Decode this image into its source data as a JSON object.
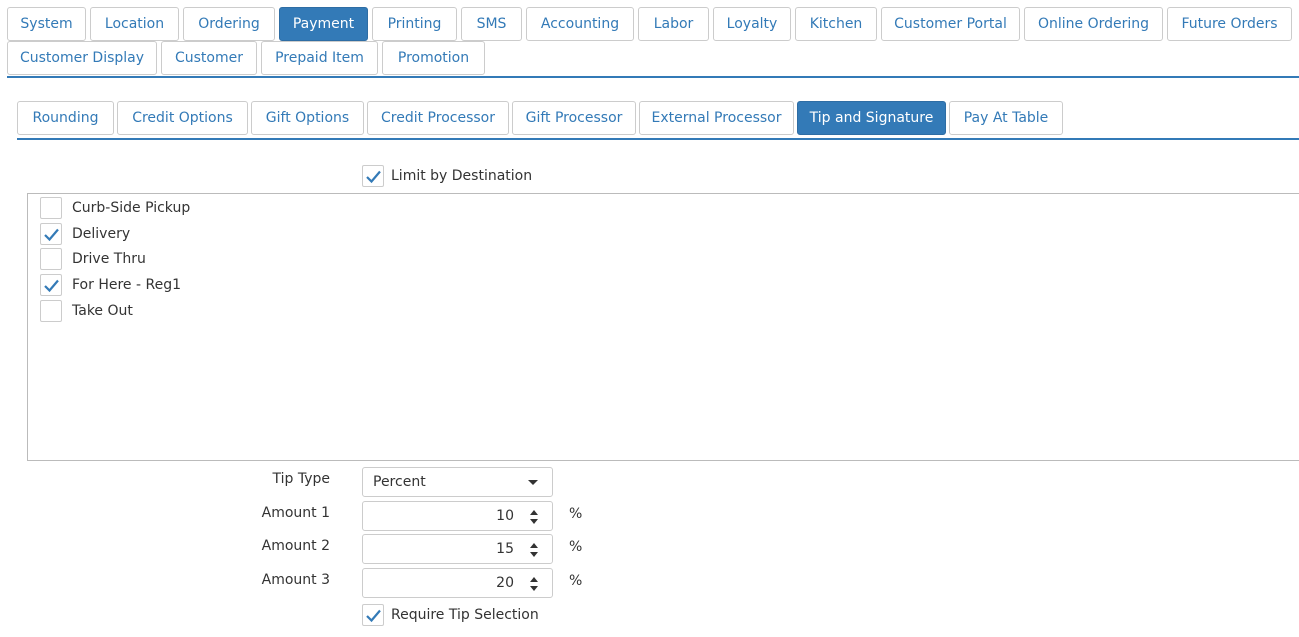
{
  "top_tabs_row1": [
    {
      "label": "System"
    },
    {
      "label": "Location"
    },
    {
      "label": "Ordering"
    },
    {
      "label": "Payment",
      "active": true
    },
    {
      "label": "Printing"
    },
    {
      "label": "SMS"
    },
    {
      "label": "Accounting"
    },
    {
      "label": "Labor"
    },
    {
      "label": "Loyalty"
    },
    {
      "label": "Kitchen"
    },
    {
      "label": "Customer Portal"
    },
    {
      "label": "Online Ordering"
    },
    {
      "label": "Future Orders"
    }
  ],
  "top_tabs_row2": [
    {
      "label": "Customer Display"
    },
    {
      "label": "Customer"
    },
    {
      "label": "Prepaid Item"
    },
    {
      "label": "Promotion"
    }
  ],
  "sub_tabs": [
    {
      "label": "Rounding"
    },
    {
      "label": "Credit Options"
    },
    {
      "label": "Gift Options"
    },
    {
      "label": "Credit Processor"
    },
    {
      "label": "Gift Processor"
    },
    {
      "label": "External Processor"
    },
    {
      "label": "Tip and Signature",
      "active": true
    },
    {
      "label": "Pay At Table"
    }
  ],
  "limit_by_destination": {
    "label": "Limit by Destination",
    "checked": true
  },
  "destinations": [
    {
      "label": "Curb-Side Pickup",
      "checked": false
    },
    {
      "label": "Delivery",
      "checked": true
    },
    {
      "label": "Drive Thru",
      "checked": false
    },
    {
      "label": "For Here - Reg1",
      "checked": true
    },
    {
      "label": "Take Out",
      "checked": false
    }
  ],
  "tip_type": {
    "label": "Tip Type",
    "value": "Percent"
  },
  "amounts": [
    {
      "label": "Amount 1",
      "value": "10",
      "unit": "%"
    },
    {
      "label": "Amount 2",
      "value": "15",
      "unit": "%"
    },
    {
      "label": "Amount 3",
      "value": "20",
      "unit": "%"
    }
  ],
  "require_tip_selection": {
    "label": "Require Tip Selection",
    "checked": true
  },
  "colors": {
    "accent": "#337ab7",
    "border": "#cccccc",
    "text": "#333333"
  },
  "icons": {
    "checkmark": "check-icon",
    "dropdown": "caret-down-icon",
    "spinner": "spinner-arrows-icon"
  }
}
